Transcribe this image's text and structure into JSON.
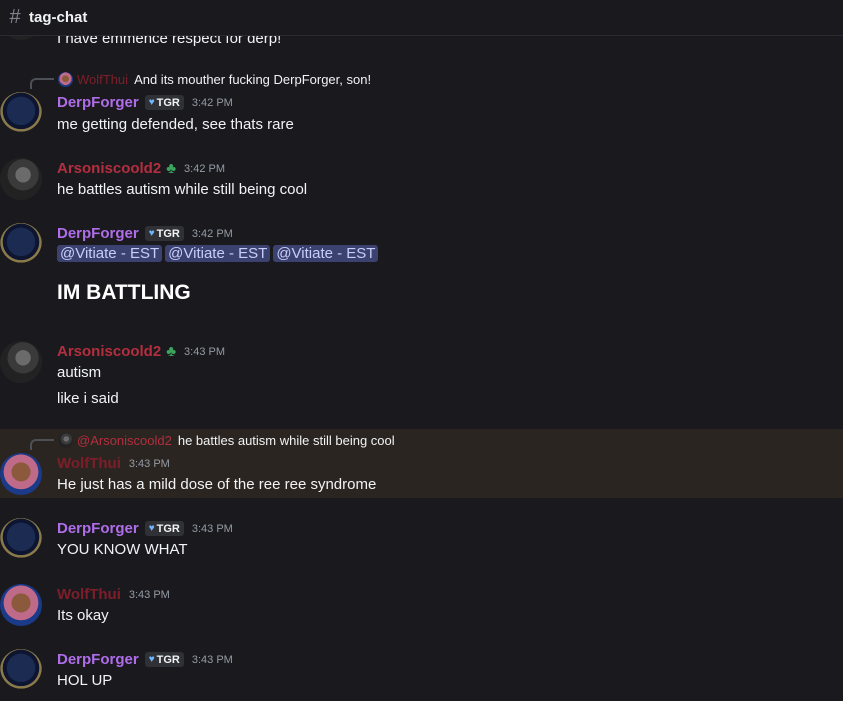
{
  "channel": {
    "icon": "hashtag-icon",
    "name": "tag-chat"
  },
  "messages": [
    {
      "text": "I have emmence respect for derp!"
    },
    {
      "reply": {
        "user": "WolfThui",
        "text": "And its mouther fucking DerpForger, son!"
      },
      "user": "DerpForger",
      "tag": "TGR",
      "time": "3:42 PM",
      "text": "me getting defended, see thats rare"
    },
    {
      "user": "Arsoniscoold2",
      "time": "3:42 PM",
      "text": "he battles autism while still being cool"
    },
    {
      "user": "DerpForger",
      "tag": "TGR",
      "time": "3:42 PM",
      "mentions": [
        "@Vitiate - EST",
        "@Vitiate - EST",
        "@Vitiate - EST"
      ],
      "big_text": "IM BATTLING"
    },
    {
      "user": "Arsoniscoold2",
      "time": "3:43 PM",
      "lines": [
        "autism",
        "like i said"
      ]
    },
    {
      "reply": {
        "user": "@Arsoniscoold2",
        "text": "he battles autism while still being cool"
      },
      "user": "WolfThui",
      "time": "3:43 PM",
      "text": "He just has a mild dose of the ree ree syndrome"
    },
    {
      "user": "DerpForger",
      "tag": "TGR",
      "time": "3:43 PM",
      "text": "YOU KNOW WHAT"
    },
    {
      "user": "WolfThui",
      "time": "3:43 PM",
      "text": "Its okay"
    },
    {
      "user": "DerpForger",
      "tag": "TGR",
      "time": "3:43 PM",
      "text": "HOL UP"
    }
  ],
  "colors": {
    "background": "#1a1a1e",
    "derp": "#b06dea",
    "arson": "#b32e3e",
    "wolf": "#7e1e2a",
    "mention_bg": "#3c4270",
    "highlight": "#2a2521"
  }
}
